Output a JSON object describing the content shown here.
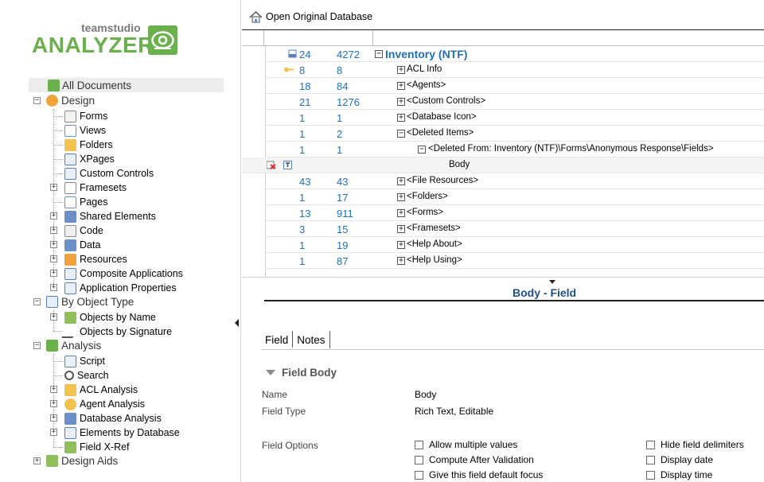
{
  "logo": {
    "top_text": "teamstudio",
    "main_text": "ANALYZER"
  },
  "tree": {
    "all_documents": "All Documents",
    "design": {
      "label": "Design",
      "items": [
        "Forms",
        "Views",
        "Folders",
        "XPages",
        "Custom Controls",
        "Framesets",
        "Pages",
        "Shared Elements",
        "Code",
        "Data",
        "Resources",
        "Composite Applications",
        "Application Properties"
      ]
    },
    "by_object_type": {
      "label": "By Object Type",
      "items": [
        "Objects by Name",
        "Objects by Signature"
      ]
    },
    "analysis": {
      "label": "Analysis",
      "items": [
        "Script",
        "Search",
        "ACL Analysis",
        "Agent Analysis",
        "Database Analysis",
        "Elements by Database",
        "Field X-Ref"
      ]
    },
    "design_aids": {
      "label": "Design Aids"
    }
  },
  "toolbar": {
    "open_label": "Open Original Database"
  },
  "grid": {
    "root": {
      "n1": "24",
      "n2": "4272",
      "label": "Inventory (NTF)"
    },
    "rows": [
      {
        "n1": "8",
        "n2": "8",
        "label": "ACL Info"
      },
      {
        "n1": "18",
        "n2": "84",
        "label": "<Agents>"
      },
      {
        "n1": "21",
        "n2": "1276",
        "label": "<Custom Controls>"
      },
      {
        "n1": "1",
        "n2": "1",
        "label": "<Database Icon>"
      },
      {
        "n1": "1",
        "n2": "2",
        "label": "<Deleted Items>"
      },
      {
        "n1": "1",
        "n2": "1",
        "label": "<Deleted From: Inventory (NTF)\\Forms\\Anonymous Response\\Fields>"
      }
    ],
    "body_row": {
      "label": "Body"
    },
    "rows_after": [
      {
        "n1": "43",
        "n2": "43",
        "label": "<File Resources>"
      },
      {
        "n1": "1",
        "n2": "17",
        "label": "<Folders>"
      },
      {
        "n1": "13",
        "n2": "911",
        "label": "<Forms>"
      },
      {
        "n1": "3",
        "n2": "15",
        "label": "<Framesets>"
      },
      {
        "n1": "1",
        "n2": "19",
        "label": "<Help About>"
      },
      {
        "n1": "1",
        "n2": "87",
        "label": "<Help Using>"
      }
    ]
  },
  "detail": {
    "title": "Body - Field",
    "tabs": [
      "Field",
      "Notes"
    ],
    "section": "Field Body",
    "props": {
      "name_label": "Name",
      "name_value": "Body",
      "type_label": "Field Type",
      "type_value": "Rich Text, Editable",
      "options_label": "Field Options"
    },
    "options_left": [
      "Allow multiple values",
      "Compute After Validation",
      "Give this field default focus"
    ],
    "options_right": [
      "Hide field delimiters",
      "Display date",
      "Display time"
    ]
  },
  "colors": {
    "brand_green": "#6ab04c",
    "link_blue": "#1f6fbf",
    "title_blue": "#1f4e8c"
  }
}
